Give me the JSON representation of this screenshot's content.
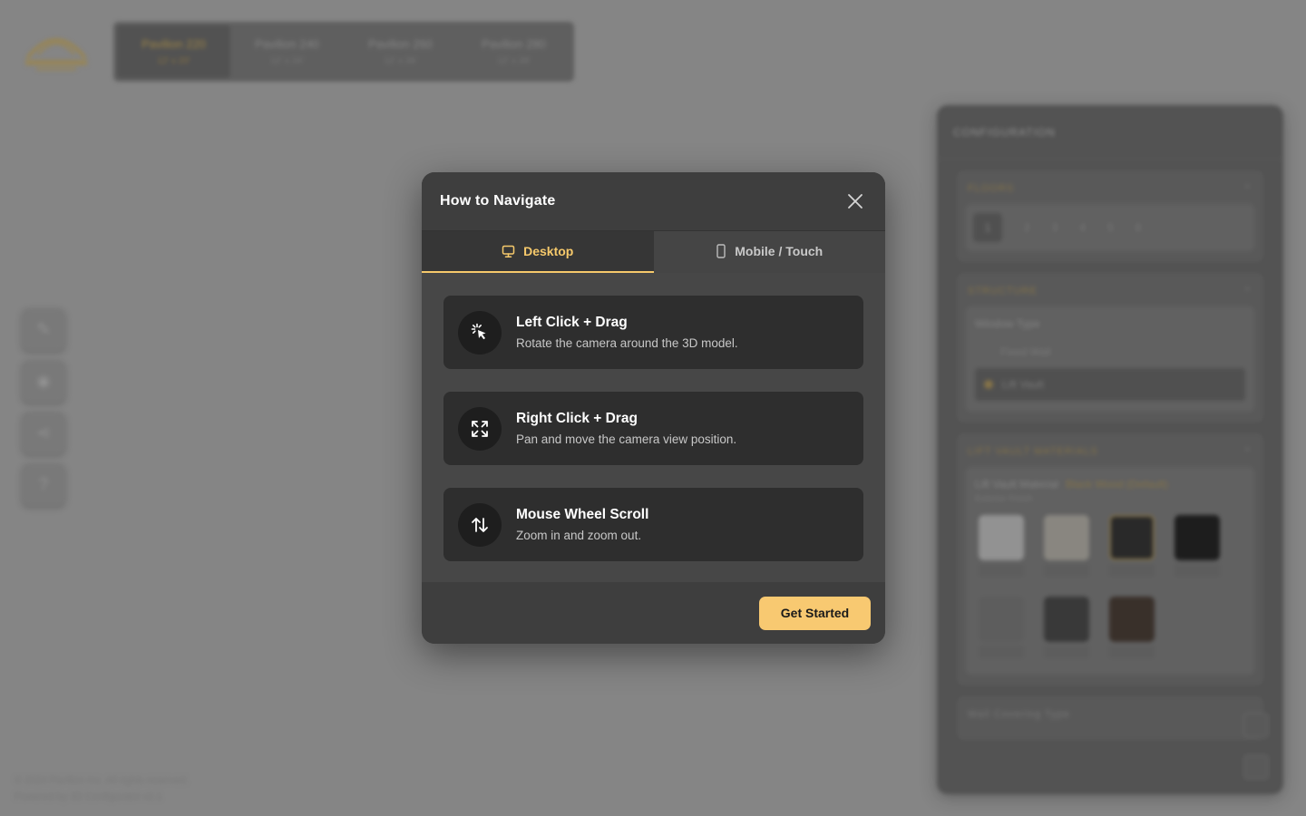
{
  "background": {
    "model_tabs": [
      {
        "name": "Pavilion 220",
        "sub": "12' x 20'",
        "active": true
      },
      {
        "name": "Pavilion 240",
        "sub": "12' x 24'",
        "active": false
      },
      {
        "name": "Pavilion 260",
        "sub": "12' x 26'",
        "active": false
      },
      {
        "name": "Pavilion 280",
        "sub": "12' x 28'",
        "active": false
      }
    ],
    "footer": {
      "line1": "© 2024 Pavilion Inc. All rights reserved.",
      "line2": "Powered by 3D Configurator v2.1"
    },
    "config": {
      "title": "CONFIGURATION",
      "sections": {
        "floors": {
          "label": "FLOORS",
          "options": [
            "1",
            "2",
            "3",
            "4",
            "5",
            "6"
          ]
        },
        "structure": {
          "label": "STRUCTURE",
          "field": "Window Type",
          "options": [
            "Fixed Wall",
            "Lift Vault"
          ]
        },
        "materials": {
          "label": "LIFT VAULT MATERIALS",
          "field": "Lift Vault Material",
          "selected": "Black Wood (Default)",
          "sub": "Exterior Finish"
        },
        "bottom": {
          "label": "Wall Covering Type"
        }
      }
    }
  },
  "modal": {
    "title": "How to Navigate",
    "tabs": [
      {
        "label": "Desktop",
        "icon": "monitor-icon",
        "active": true
      },
      {
        "label": "Mobile / Touch",
        "icon": "phone-icon",
        "active": false
      }
    ],
    "instructions": [
      {
        "icon": "click-cursor-icon",
        "title": "Left Click + Drag",
        "desc": "Rotate the camera around the 3D model."
      },
      {
        "icon": "expand-arrows-icon",
        "title": "Right Click + Drag",
        "desc": "Pan and move the camera view position."
      },
      {
        "icon": "up-down-arrows-icon",
        "title": "Mouse Wheel Scroll",
        "desc": "Zoom in and zoom out."
      }
    ],
    "primary_button": "Get Started",
    "colors": {
      "accent": "#f6c96b",
      "button": "#f8c971",
      "panel": "#3e3e3e",
      "card": "#2e2e2e"
    }
  }
}
